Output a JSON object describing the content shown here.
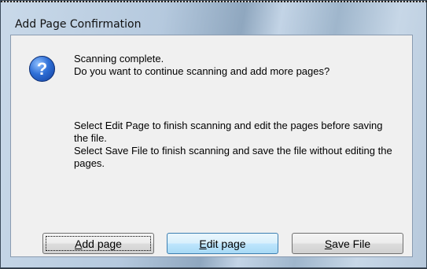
{
  "dialog": {
    "title": "Add Page Confirmation",
    "icon": "question-icon",
    "message_line1": "Scanning complete.",
    "message_line2": "Do you want to continue scanning and add more pages?",
    "detail_line1": "Select Edit Page to finish scanning and edit the pages before saving the file.",
    "detail_line2": "Select Save File to finish scanning and save the file without editing the pages."
  },
  "buttons": {
    "add_mnemonic": "A",
    "add_rest": "dd page",
    "edit_mnemonic": "E",
    "edit_rest": "dit page",
    "save_mnemonic": "S",
    "save_rest": "ave File"
  },
  "colors": {
    "title_gradient": "#b5c9de",
    "content_bg": "#f0f0f0",
    "default_button": "#bee6fd"
  }
}
